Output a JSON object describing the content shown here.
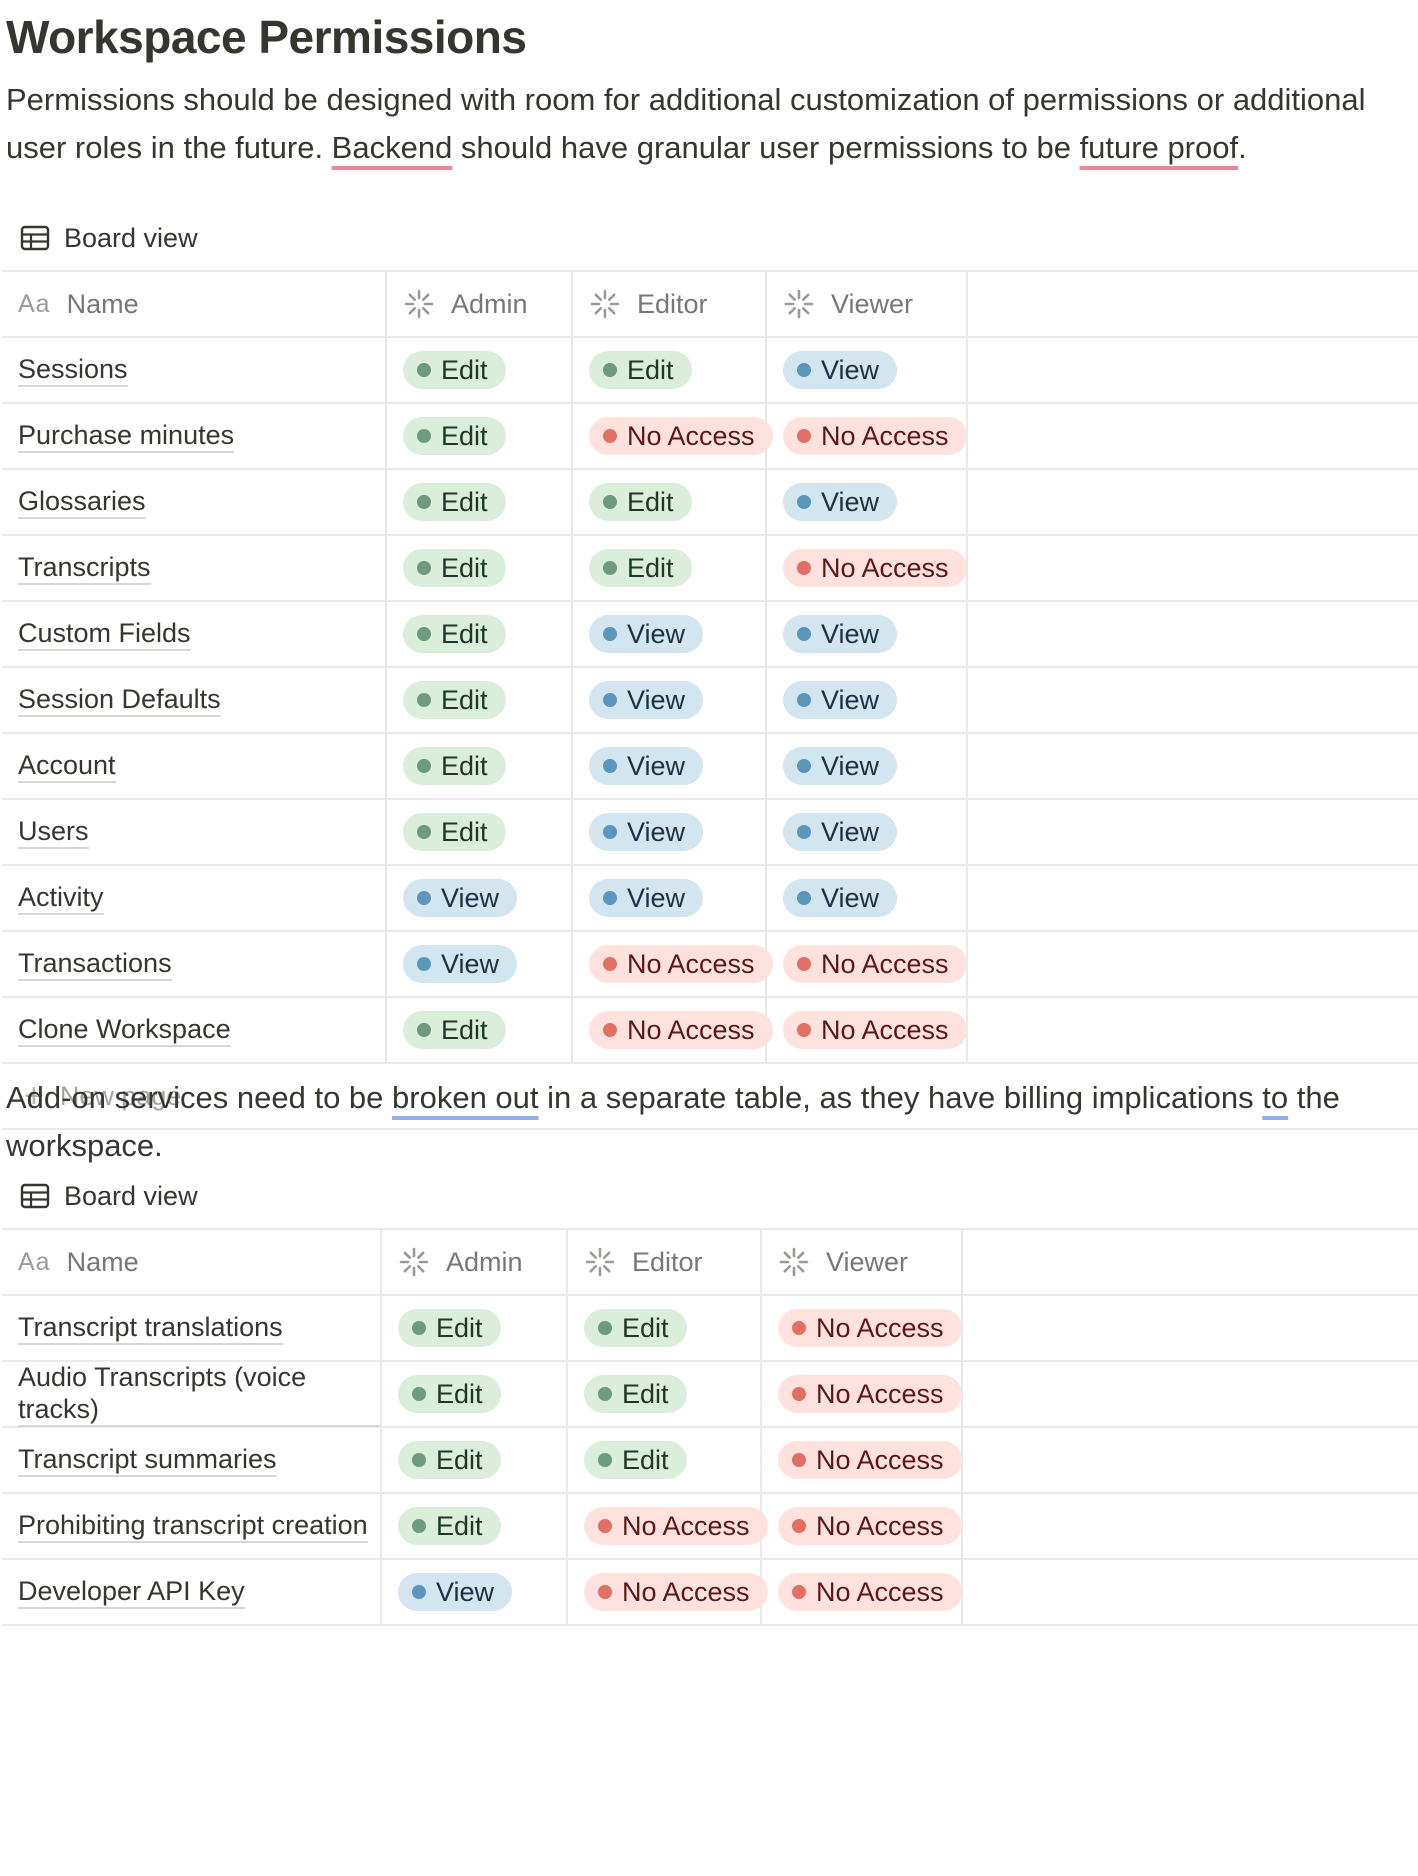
{
  "page": {
    "title": "Workspace Permissions",
    "intro_part1": "Permissions should be designed with room for additional customization of permissions or additional user roles in the future. ",
    "intro_backend": "Backend",
    "intro_part2": " should have granular user permissions to be ",
    "intro_future": "future proof",
    "intro_end": ".",
    "addon_part1": "Add-on services need to be ",
    "addon_broken": "broken out",
    "addon_part2": " in a separate table, as they have billing implications ",
    "addon_to": "to",
    "addon_part3": " the workspace."
  },
  "table1": {
    "view_label": "Board view",
    "headers": {
      "name_prefix": "Aa",
      "name": "Name",
      "admin": "Admin",
      "editor": "Editor",
      "viewer": "Viewer"
    },
    "rows": [
      {
        "name": "Sessions",
        "admin": "Edit",
        "editor": "Edit",
        "viewer": "View"
      },
      {
        "name": "Purchase minutes",
        "admin": "Edit",
        "editor": "No Access",
        "viewer": "No Access"
      },
      {
        "name": "Glossaries",
        "admin": "Edit",
        "editor": "Edit",
        "viewer": "View"
      },
      {
        "name": "Transcripts",
        "admin": "Edit",
        "editor": "Edit",
        "viewer": "No Access"
      },
      {
        "name": "Custom Fields",
        "admin": "Edit",
        "editor": "View",
        "viewer": "View"
      },
      {
        "name": "Session Defaults",
        "admin": "Edit",
        "editor": "View",
        "viewer": "View"
      },
      {
        "name": "Account",
        "admin": "Edit",
        "editor": "View",
        "viewer": "View"
      },
      {
        "name": "Users",
        "admin": "Edit",
        "editor": "View",
        "viewer": "View"
      },
      {
        "name": "Activity",
        "admin": "View",
        "editor": "View",
        "viewer": "View"
      },
      {
        "name": "Transactions",
        "admin": "View",
        "editor": "No Access",
        "viewer": "No Access"
      },
      {
        "name": "Clone Workspace",
        "admin": "Edit",
        "editor": "No Access",
        "viewer": "No Access"
      }
    ],
    "new_page_label": "New page"
  },
  "table2": {
    "view_label": "Board view",
    "headers": {
      "name_prefix": "Aa",
      "name": "Name",
      "admin": "Admin",
      "editor": "Editor",
      "viewer": "Viewer"
    },
    "rows": [
      {
        "name": "Transcript translations",
        "admin": "Edit",
        "editor": "Edit",
        "viewer": "No Access"
      },
      {
        "name": "Audio Transcripts (voice tracks)",
        "admin": "Edit",
        "editor": "Edit",
        "viewer": "No Access"
      },
      {
        "name": "Transcript summaries",
        "admin": "Edit",
        "editor": "Edit",
        "viewer": "No Access"
      },
      {
        "name": "Prohibiting transcript creation",
        "admin": "Edit",
        "editor": "No Access",
        "viewer": "No Access"
      },
      {
        "name": "Developer API Key",
        "admin": "View",
        "editor": "No Access",
        "viewer": "No Access"
      }
    ]
  },
  "tag_colors": {
    "Edit": {
      "bg": "#dbeddb",
      "dot": "#6c9b7d"
    },
    "View": {
      "bg": "#d3e5ef",
      "dot": "#5b97bd"
    },
    "No Access": {
      "bg": "#ffe2dd",
      "dot": "#e16f64"
    }
  },
  "icons": {
    "view": "table-icon",
    "column": "status-spinner-icon",
    "new": "plus-icon"
  }
}
